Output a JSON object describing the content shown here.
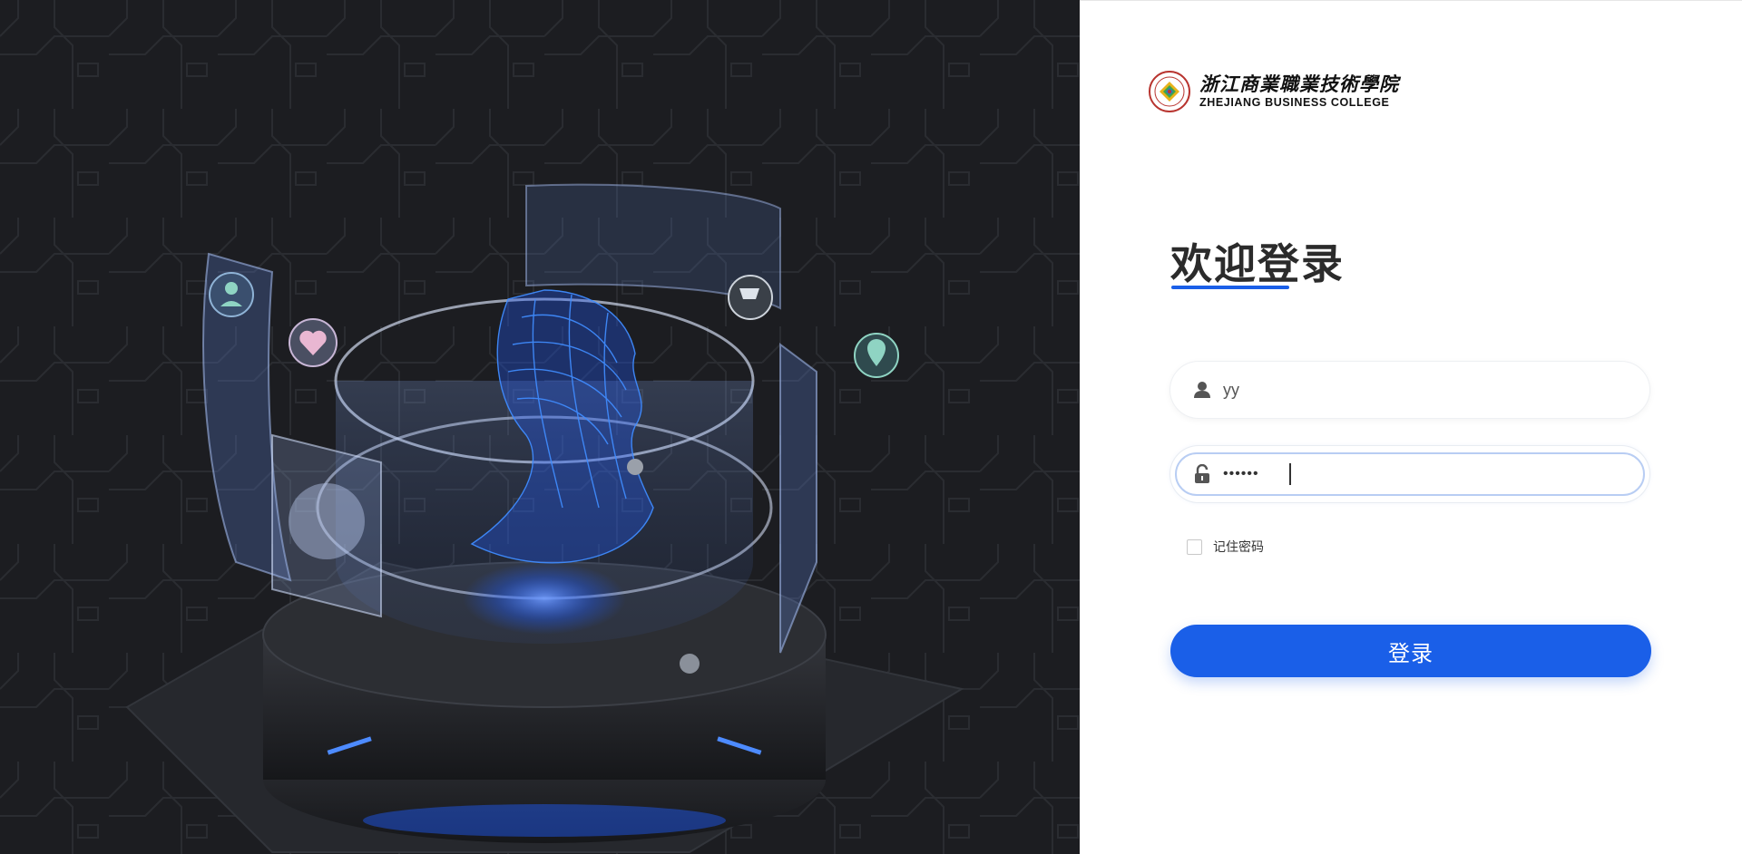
{
  "brand": {
    "name_cn": "浙江商業職業技術學院",
    "name_en": "ZHEJIANG BUSINESS COLLEGE",
    "seal_icon": "college-seal-icon"
  },
  "login": {
    "title": "欢迎登录",
    "username": {
      "value": "yy",
      "icon": "user-icon"
    },
    "password": {
      "value": "••••••",
      "icon": "unlock-icon"
    },
    "remember_label": "记住密码",
    "remember_checked": false,
    "submit_label": "登录"
  },
  "colors": {
    "accent": "#1a5fe8",
    "hero_background": "#1c1d21",
    "hologram": "#2f7bff"
  }
}
